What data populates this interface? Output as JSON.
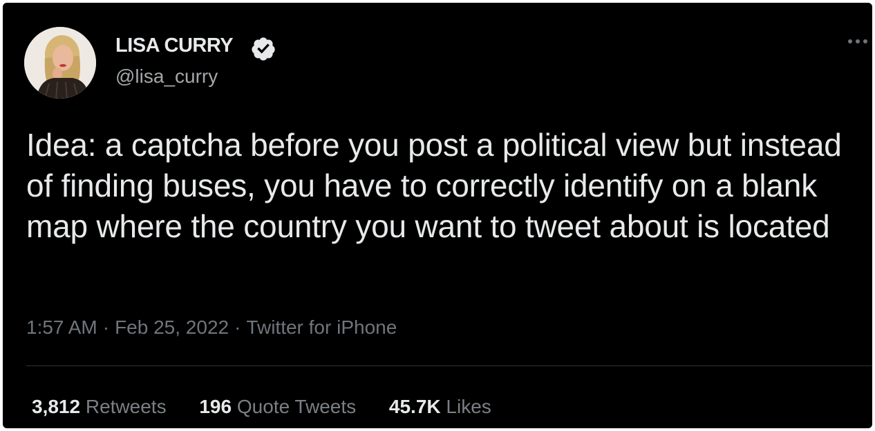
{
  "tweet": {
    "author": {
      "display_name": "LISA CURRY",
      "handle": "@lisa_curry",
      "verified": true
    },
    "text": "Idea: a captcha before you post a political view but instead of finding buses, you have to correctly identify on a blank map where the country you want to tweet about is located",
    "meta": {
      "time": "1:57 AM",
      "separator": "·",
      "date": "Feb 25, 2022",
      "source": "Twitter for iPhone"
    },
    "stats": {
      "retweets_count": "3,812",
      "retweets_label": "Retweets",
      "quotes_count": "196",
      "quotes_label": "Quote Tweets",
      "likes_count": "45.7K",
      "likes_label": "Likes"
    }
  },
  "colors": {
    "background": "#000000",
    "primary_text": "#e7e9ea",
    "secondary_text": "#71767b",
    "verified_badge": "#e7e9ea",
    "divider": "#2f3336"
  },
  "icons": {
    "verified": "verified-badge-icon",
    "more": "more-options-icon"
  }
}
